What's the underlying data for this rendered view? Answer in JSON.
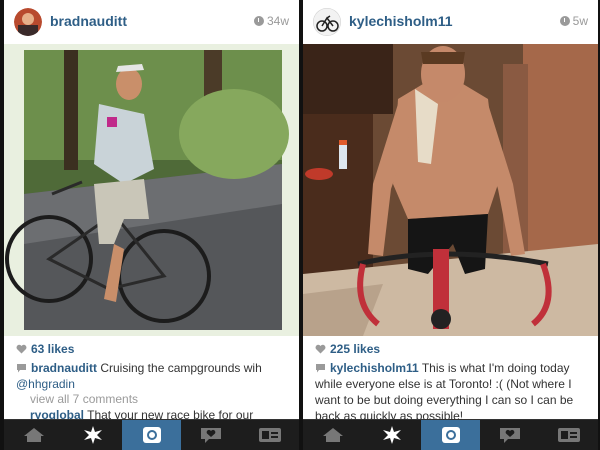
{
  "left_post": {
    "username": "bradnauditt",
    "time": "34w",
    "likes": "63 likes",
    "caption_user": "bradnauditt",
    "caption_text": " Cruising the campgrounds wih ",
    "caption_mention": "@hhgradin",
    "comments_link": "view all 7 comments",
    "next_comment_user": "ryoglobal",
    "next_comment_text": " That your new race bike for our"
  },
  "right_post": {
    "username": "kylechisholm11",
    "time": "5w",
    "likes": "225 likes",
    "caption_user": "kylechisholm11",
    "caption_text": " This is what I'm doing today while everyone else is at Toronto! :( (Not where I want to be but doing everything I can so I can be back as quickly as possible!"
  },
  "tabbar": {
    "tabs": [
      "home-icon",
      "explore-icon",
      "camera-icon",
      "news-icon",
      "profile-icon"
    ],
    "active_index": 2
  },
  "colors": {
    "link": "#2e5e86",
    "active_tab": "#3b6f9b",
    "tabbar": "#1d1d1d"
  }
}
